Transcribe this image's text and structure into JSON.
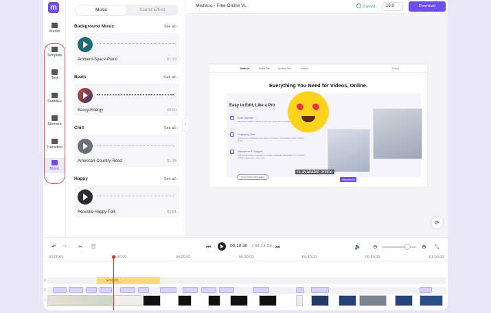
{
  "app": {
    "doc_title": "Media.io - Free Online Vi...",
    "saved": "Saved",
    "ratio": "16:9",
    "download": "Download"
  },
  "rail": [
    {
      "label": "Media",
      "icon": "folder-icon"
    },
    {
      "label": "Template",
      "icon": "template-icon"
    },
    {
      "label": "Text",
      "icon": "text-icon"
    },
    {
      "label": "Subtitles",
      "icon": "subtitles-icon"
    },
    {
      "label": "Element",
      "icon": "element-icon"
    },
    {
      "label": "Transition",
      "icon": "transition-icon"
    },
    {
      "label": "Music",
      "icon": "music-icon",
      "active": true
    }
  ],
  "panel": {
    "tabs": [
      "Music",
      "Sound Effect"
    ],
    "see_all": "See all",
    "sections": [
      {
        "title": "Background Music",
        "track": "Ambient-Space-Piano",
        "duration": "01:39"
      },
      {
        "title": "Beats",
        "track": "Bassy-Energy",
        "duration": "02:00"
      },
      {
        "title": "Chill",
        "track": "American-Country-Road",
        "duration": "01:45"
      },
      {
        "title": "Happy",
        "track": "Acoustic-Happy-Folk",
        "duration": "01:01"
      }
    ]
  },
  "preview": {
    "nav": [
      "Media.io",
      "Online Tool",
      "Desktop Tool",
      "Support",
      "Pricing"
    ],
    "headline": "Everything You Need for Videos, Online.",
    "easy": "Easy to Edit, Like a Pro",
    "features": [
      {
        "title": "Auto Subtitle",
        "desc": "Generate subtitles and sync with your video automatically with AI."
      },
      {
        "title": "Engaging Text",
        "desc": "Add text to emphasize your videos or images. Personalize it with various styles."
      },
      {
        "title": "Waveform & Shapes",
        "desc": "Add sound waves or shapes to create a beautiful visual effect for youtube, social media posts, and more."
      }
    ],
    "cta": "Show Online Video Editor",
    "badge": "Basketball",
    "banner": "is available online"
  },
  "timeline": {
    "current": "00:10.30",
    "total": "/ 04:14.28",
    "ruler": [
      "00:00.00",
      "00:10.00",
      "00:20.00",
      "00:30.00",
      "00:40.00",
      "00:50.00",
      "01:00.00"
    ],
    "emoji_clip": "Emoji01",
    "tracks": [
      "2",
      "2",
      "1"
    ]
  }
}
